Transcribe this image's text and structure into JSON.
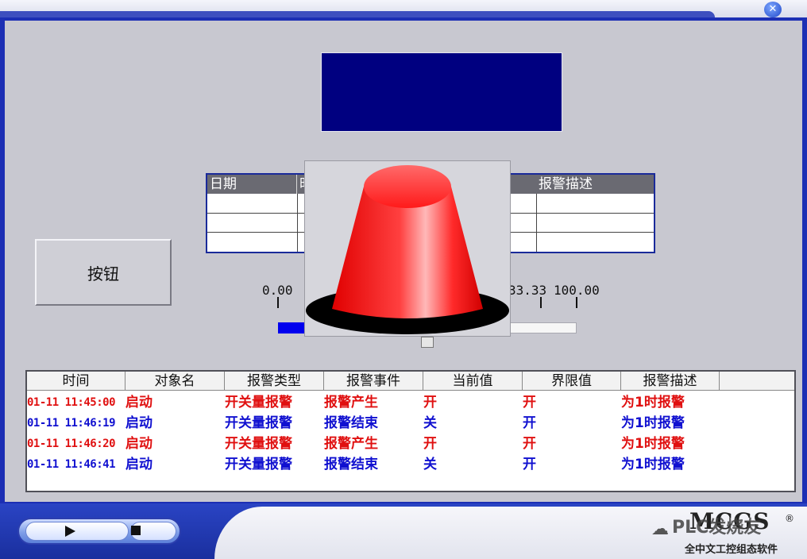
{
  "window": {
    "close_glyph": "✕"
  },
  "main": {
    "button_label": "按钮"
  },
  "alarm_table": {
    "headers": [
      "日期",
      "时",
      "报警描述"
    ]
  },
  "scale": {
    "min_label": "0.00",
    "mid_label": "33.33",
    "max_label": "100.00",
    "fill_fraction": 0.1
  },
  "lamp": {
    "color": "#ff1e1e",
    "state": "on"
  },
  "log": {
    "headers": [
      "时间",
      "对象名",
      "报警类型",
      "报警事件",
      "当前值",
      "界限值",
      "报警描述"
    ],
    "rows": [
      {
        "time": "01-11 11:45:00",
        "object": "启动",
        "type": "开关量报警",
        "event": "报警产生",
        "value": "开",
        "limit": "开",
        "desc": "为1时报警",
        "color": "#e01010"
      },
      {
        "time": "01-11 11:46:19",
        "object": "启动",
        "type": "开关量报警",
        "event": "报警结束",
        "value": "关",
        "limit": "开",
        "desc": "为1时报警",
        "color": "#1010d0"
      },
      {
        "time": "01-11 11:46:20",
        "object": "启动",
        "type": "开关量报警",
        "event": "报警产生",
        "value": "开",
        "limit": "开",
        "desc": "为1时报警",
        "color": "#e01010"
      },
      {
        "time": "01-11 11:46:41",
        "object": "启动",
        "type": "开关量报警",
        "event": "报警结束",
        "value": "关",
        "limit": "开",
        "desc": "为1时报警",
        "color": "#1010d0"
      }
    ]
  },
  "footer": {
    "brand": "MCGS",
    "brand_sub": "全中文工控组态软件",
    "watermark": "PLC发烧友",
    "registered": "®"
  }
}
